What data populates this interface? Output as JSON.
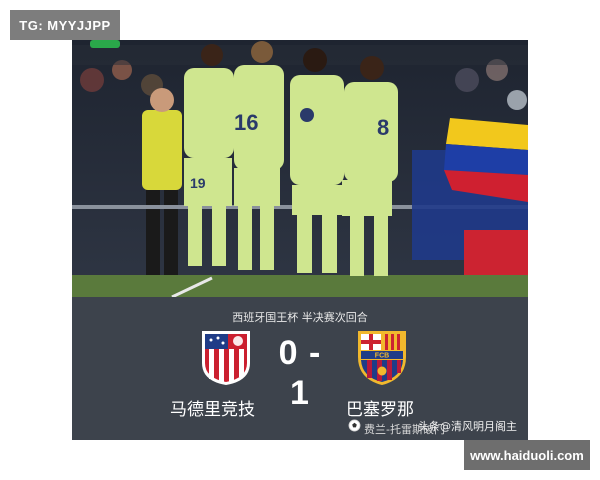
{
  "watermark_top": "TG: MYYJJPP",
  "photo": {
    "shirt_numbers": [
      "16",
      "19",
      "8"
    ]
  },
  "match": {
    "competition": "西班牙国王杯 半决赛次回合",
    "score": "0 - 1",
    "home_team": "马德里竞技",
    "away_team": "巴塞罗那",
    "away_crest_text": "FCB"
  },
  "watermark_source": "头条@清风明月阁主",
  "watermark_sub": "费兰-托雷斯破门",
  "watermark_bottom": "www.haiduoli.com",
  "colors": {
    "kit": "#cfe68f",
    "card_bg": "#3d434c",
    "pitch": "#5a7a3c",
    "atletico_red": "#cb1f2f",
    "barca_blue": "#1f3c87",
    "barca_red": "#b5193c",
    "barca_gold": "#f1b82d"
  }
}
